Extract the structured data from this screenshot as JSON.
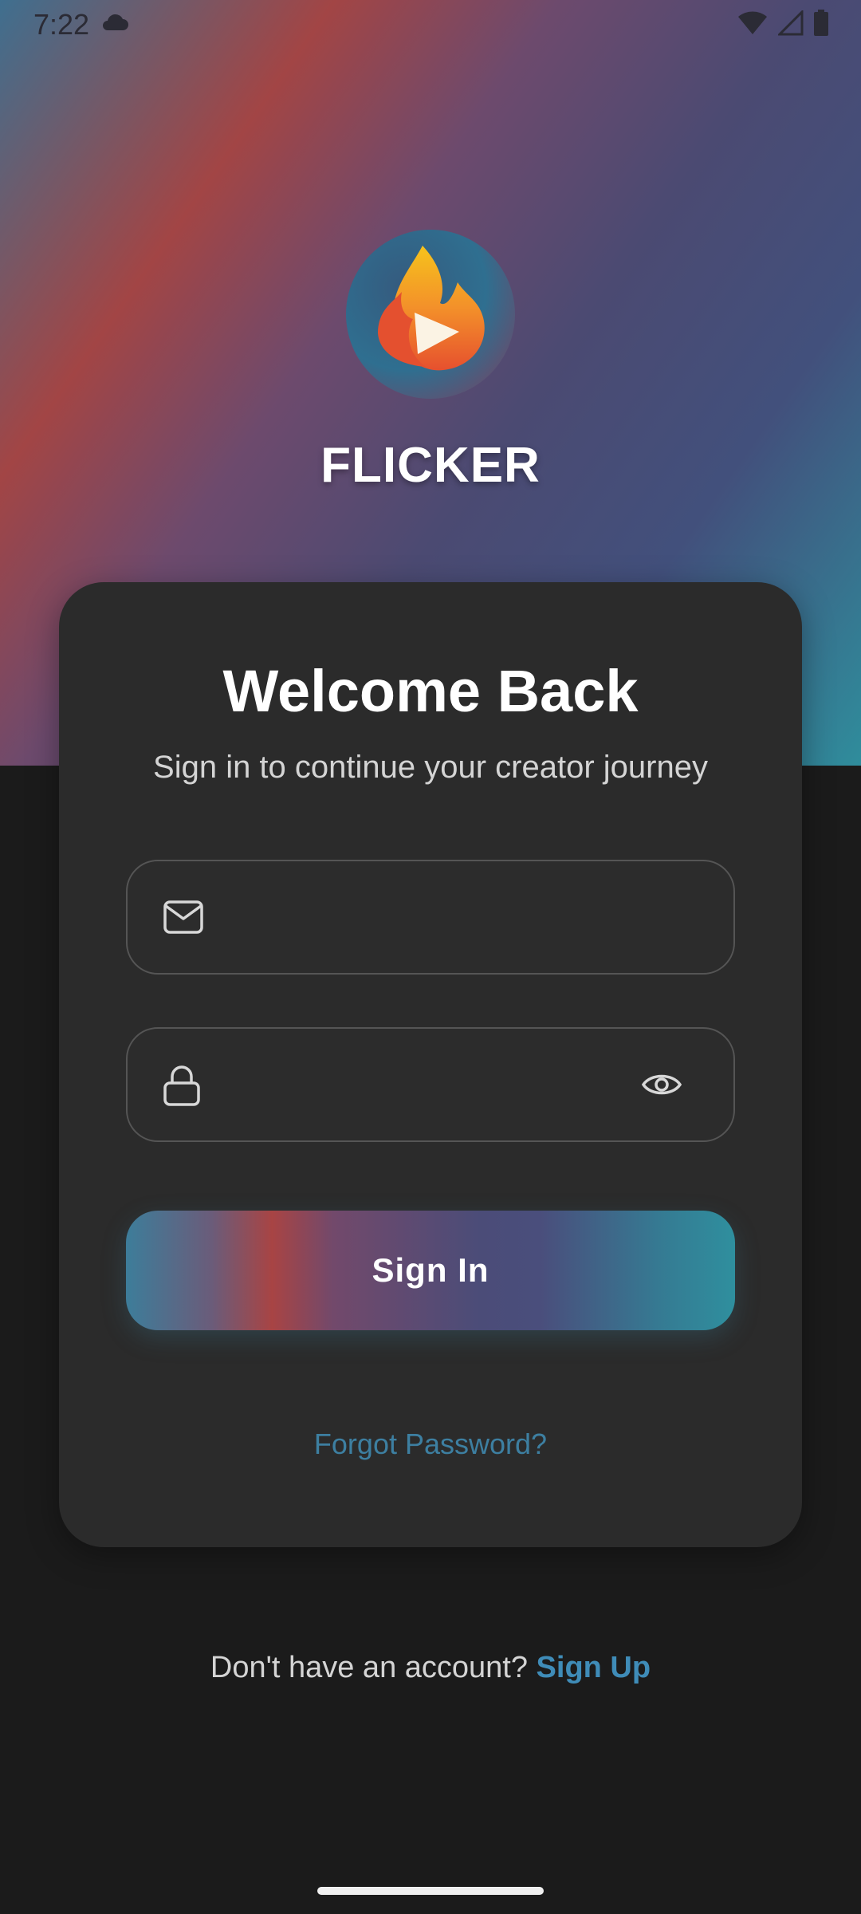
{
  "status_bar": {
    "time": "7:22"
  },
  "app": {
    "name": "FLICKER"
  },
  "card": {
    "title": "Welcome Back",
    "subtitle": "Sign in to continue your creator journey",
    "email_field": {
      "value": "",
      "placeholder": "",
      "icon": "mail-icon"
    },
    "password_field": {
      "value": "",
      "placeholder": "",
      "icon": "lock-icon",
      "toggle_icon": "eye-icon"
    },
    "sign_in_label": "Sign In",
    "forgot_password_label": "Forgot Password?"
  },
  "footer": {
    "prompt": "Don't have an account? ",
    "sign_up_label": "Sign Up"
  },
  "colors": {
    "background": "#1b1b1b",
    "card": "#2b2b2b",
    "link": "#3d7fa1",
    "accent_red": "#a84444",
    "accent_teal": "#2f8f9e",
    "accent_indigo": "#4b4c78"
  }
}
